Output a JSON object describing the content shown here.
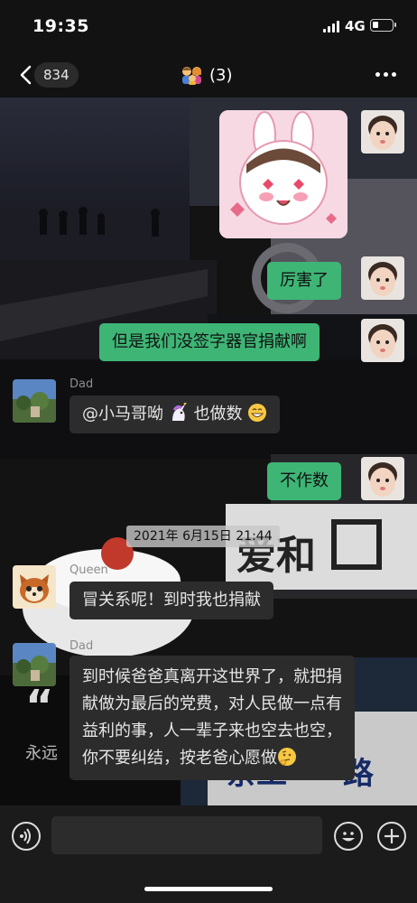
{
  "status_bar": {
    "time": "19:35",
    "network": "4G"
  },
  "nav": {
    "back_icon": "chevron-left-icon",
    "unread_count": "834",
    "title": "(3)",
    "group_icon": "family-emoji-icon",
    "more_icon": "ellipsis-icon"
  },
  "messages": [
    {
      "side": "right",
      "type": "sticker",
      "sticker": "bunny-blush-sticker"
    },
    {
      "side": "right",
      "type": "text",
      "text": "厉害了"
    },
    {
      "side": "right",
      "type": "text",
      "text": "但是我们没签字器官捐献啊"
    },
    {
      "side": "left",
      "sender": "Dad",
      "type": "text",
      "mention": "@小马哥呦",
      "text": " 也做数",
      "emoji_1": "unicorn-emoji-icon",
      "emoji_2": "grin-emoji-icon"
    },
    {
      "side": "right",
      "type": "text",
      "text": "不作数"
    },
    {
      "type": "timestamp",
      "text": "2021年 6月15日 21:44"
    },
    {
      "side": "left",
      "sender": "Queen",
      "type": "text",
      "text": "冒关系呢！到时我也捐献"
    },
    {
      "side": "left",
      "sender": "Dad",
      "type": "text",
      "text": "到时候爸爸真离开这世界了，就把捐献做为最后的党费，对人民做一点有益利的事，人一辈子来也空去也空，你不要纠结，按老爸心愿做",
      "emoji": "thinking-emoji-icon"
    }
  ],
  "input_bar": {
    "voice_icon": "voice-icon",
    "emoji_icon": "smiley-icon",
    "plus_icon": "plus-icon",
    "placeholder": ""
  },
  "colors": {
    "bubble_outgoing": "#3eb575",
    "bubble_incoming": "#2c2c2c",
    "background": "#121212"
  }
}
